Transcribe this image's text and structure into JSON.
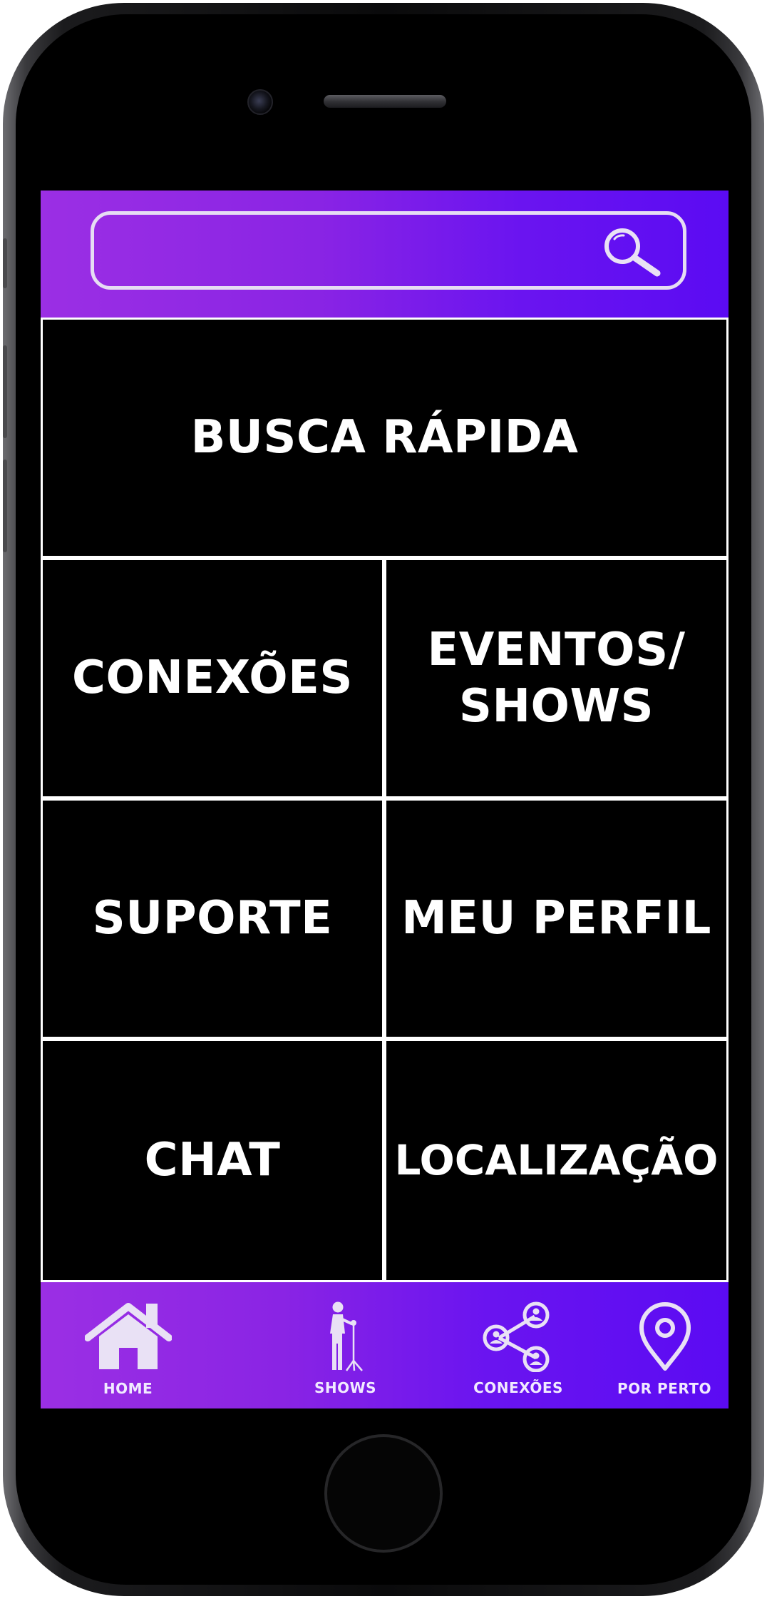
{
  "search": {
    "placeholder": "",
    "icon": "search-icon"
  },
  "menu": {
    "busca_rapida": "BUSCA RÁPIDA",
    "conexoes": "CONEXÕES",
    "eventos_line1": "EVENTOS/",
    "eventos_line2": "SHOWS",
    "suporte": "SUPORTE",
    "meu_perfil": "MEU PERFIL",
    "chat": "CHAT",
    "localizacao": "LOCALIZAÇÃO"
  },
  "tabbar": {
    "items": [
      {
        "label": "HOME",
        "icon": "house-icon"
      },
      {
        "label": "SHOWS",
        "icon": "singer-microphone-icon"
      },
      {
        "label": "CONEXÕES",
        "icon": "share-people-icon"
      },
      {
        "label": "POR PERTO",
        "icon": "location-pin-icon"
      }
    ]
  },
  "colors": {
    "gradient_start": "#9b2fe4",
    "gradient_end": "#5b0bf3",
    "tile_background": "#000000",
    "tile_text": "#ffffff",
    "grid_lines": "#ffffff"
  }
}
